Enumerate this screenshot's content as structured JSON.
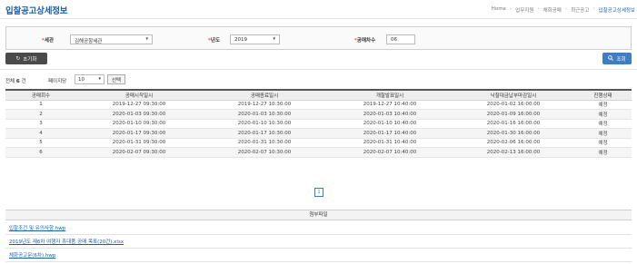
{
  "page_title": "입찰공고상세정보",
  "breadcrumb": [
    "Home",
    "업무지원",
    "체화공매",
    "최근공고",
    "입찰공고상세정보"
  ],
  "filters": {
    "customs_label": "세관",
    "customs_value": "김해공항세관",
    "year_label": "년도",
    "year_value": "2019",
    "round_label": "공매차수",
    "round_value": "06",
    "required_mark": "*"
  },
  "actions": {
    "reset_label": "초기화",
    "search_label": "조회"
  },
  "list_controls": {
    "total_prefix": "전체",
    "total_count": "6",
    "total_suffix": "건",
    "per_page_label": "페이지당",
    "per_page_value": "10",
    "select_label": "선택"
  },
  "table": {
    "columns": [
      "공매회수",
      "공매시작일시",
      "공매종료일시",
      "개찰발표일시",
      "낙찰대금납부마감일시",
      "진행상태"
    ],
    "rows": [
      [
        "1",
        "2019-12-27 09:30:00",
        "2019-12-27 10:30:00",
        "2019-12-27 10:40:00",
        "2020-01-02 16:00:00",
        "예정"
      ],
      [
        "2",
        "2020-01-03 09:30:00",
        "2020-01-03 10:30:00",
        "2020-01-03 10:40:00",
        "2020-01-09 16:00:00",
        "예정"
      ],
      [
        "3",
        "2020-01-10 09:30:00",
        "2020-01-10 10:30:00",
        "2020-01-10 10:40:00",
        "2020-01-16 16:00:00",
        "예정"
      ],
      [
        "4",
        "2020-01-17 09:30:00",
        "2020-01-17 10:30:00",
        "2020-01-17 10:40:00",
        "2020-01-30 16:00:00",
        "예정"
      ],
      [
        "5",
        "2020-01-31 09:30:00",
        "2020-01-31 10:30:00",
        "2020-01-31 10:40:00",
        "2020-02-06 16:00:00",
        "예정"
      ],
      [
        "6",
        "2020-02-07 09:30:00",
        "2020-02-07 10:30:00",
        "2020-02-07 10:40:00",
        "2020-02-13 16:00:00",
        "예정"
      ]
    ]
  },
  "pagination": {
    "current_page": "1"
  },
  "attachments": {
    "header": "첨부파일",
    "files": [
      "입찰조건 및 유의사항.hwp",
      "2019년도 제6차 여행자 휴대품 공매 목록(20건).xlsx",
      "체화공고문(6차).hwp"
    ]
  },
  "colors": {
    "accent": "#1a5fa8",
    "search_button": "#3d7fc7",
    "reset_button": "#4a4a4a",
    "required": "#d9534f"
  }
}
